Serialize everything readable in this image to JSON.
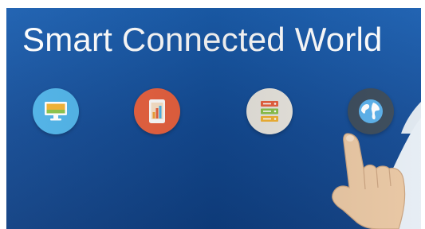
{
  "banner": {
    "title": "Smart Connected World",
    "background_color": "#134a93",
    "icons": [
      {
        "name": "desktop-monitor-icon",
        "color": "#4fb3e8"
      },
      {
        "name": "mobile-chart-icon",
        "color": "#e8613f"
      },
      {
        "name": "server-rack-icon",
        "color": "#e9e6df"
      },
      {
        "name": "globe-icon",
        "color": "#3a4a5a"
      }
    ]
  }
}
